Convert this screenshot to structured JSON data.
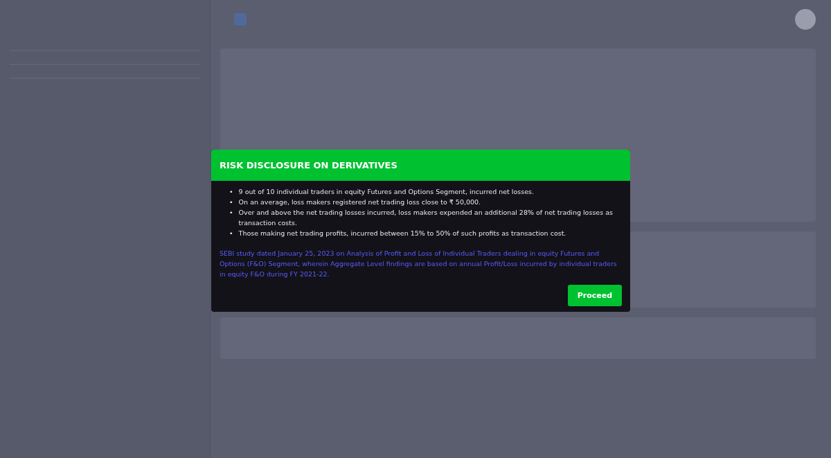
{
  "modal": {
    "title": "RISK DISCLOSURE ON DERIVATIVES",
    "bullet": "•",
    "points": [
      "9 out of 10 individual traders in equity Futures and Options Segment, incurred net losses.",
      "On an average, loss makers registered net trading loss close to ₹ 50,000.",
      "Over and above the net trading losses incurred, loss makers expended an additional 28% of net trading losses as transaction costs.",
      "Those making net trading profits, incurred between 15% to 50% of such profits as transaction cost."
    ],
    "source": "SEBI study dated January 25, 2023 on Analysis of Profit and Loss of Individual Traders dealing in equity Futures and Options (F&O) Segment, wherein Aggregate Level findings are based on annual Profit/Loss incurred by individual traders in equity F&O during FY 2021-22.",
    "button": "Proceed"
  }
}
